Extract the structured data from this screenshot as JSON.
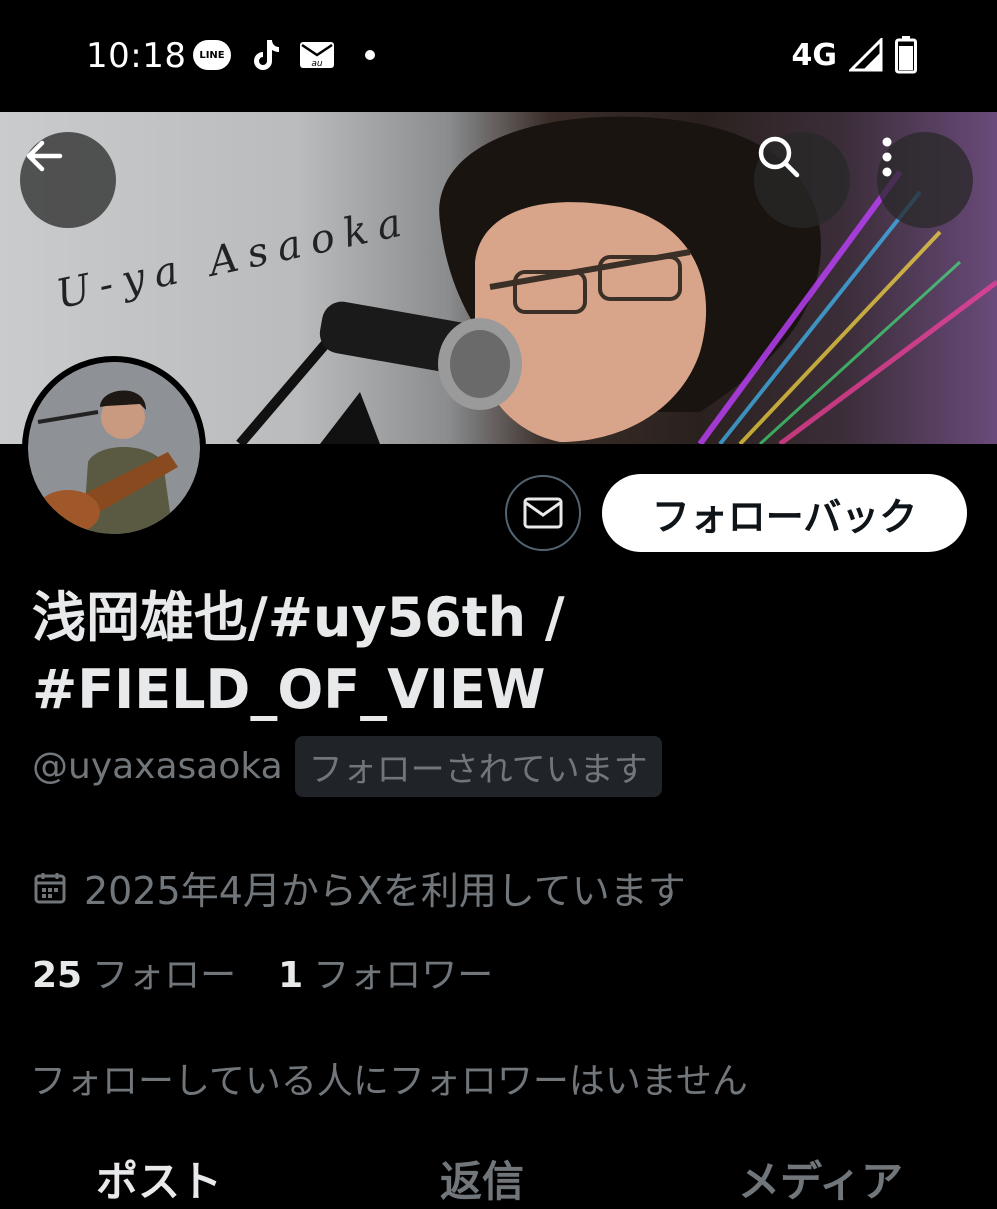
{
  "status_bar": {
    "time": "10:18",
    "network": "4G",
    "notification_icons": [
      "line-icon",
      "tiktok-icon",
      "au-mail-icon",
      "dot-icon"
    ],
    "line_label": "LINE",
    "au_label": "au"
  },
  "banner": {
    "text": "U-ya Asaoka"
  },
  "profile": {
    "follow_back_label": "フォローバック",
    "display_name": "浅岡雄也/#uy56th / #FIELD_OF_VIEW",
    "handle": "@uyaxasaoka",
    "follows_you": "フォローされています",
    "joined": "2025年4月からXを利用しています",
    "following_count": "25",
    "following_label": "フォロー",
    "followers_count": "1",
    "followers_label": "フォロワー",
    "mutual_followers": "フォローしている人にフォロワーはいません"
  },
  "tabs": [
    {
      "label": "ポスト"
    },
    {
      "label": "返信"
    },
    {
      "label": "メディア"
    }
  ],
  "colors": {
    "background": "#000000",
    "primary_text": "#e7e9ea",
    "secondary_text": "#71767b"
  }
}
